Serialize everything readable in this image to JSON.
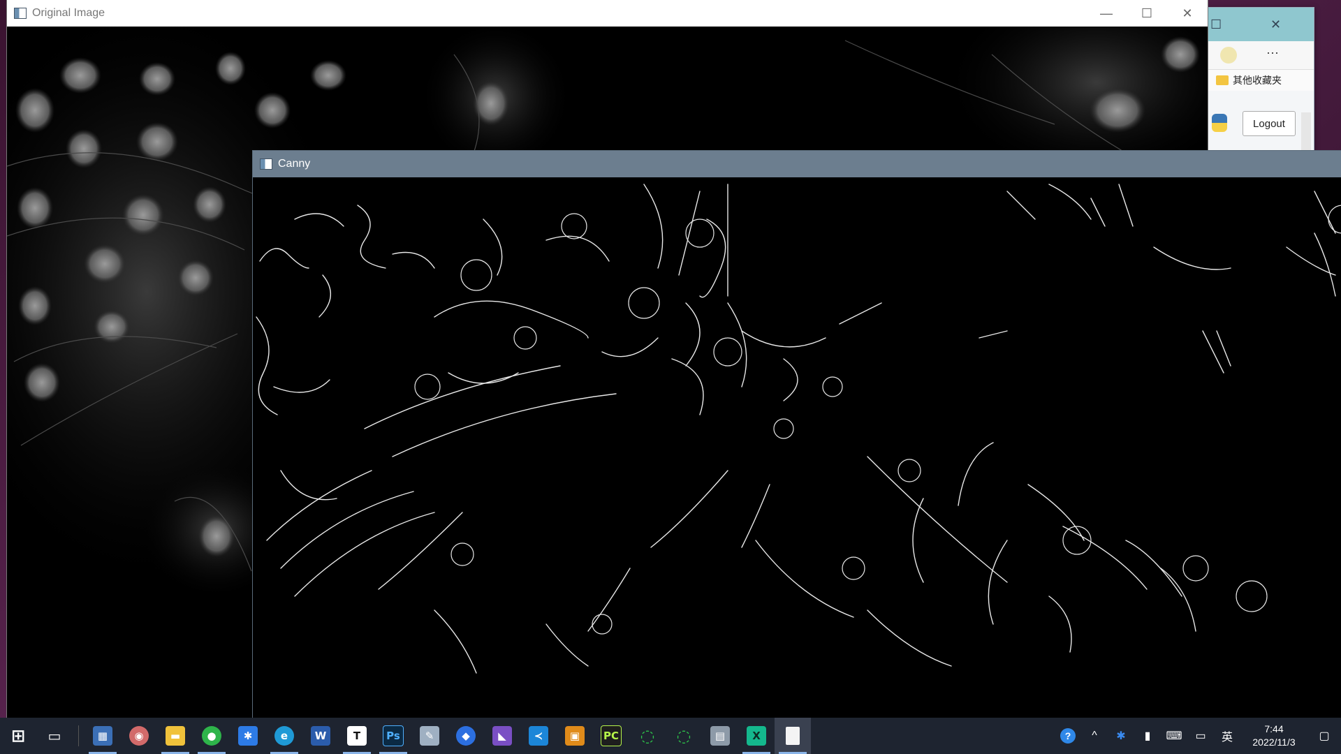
{
  "browser": {
    "favorites_folder_label": "其他收藏夹",
    "logout_label": "Logout",
    "more_label": "···"
  },
  "original_window": {
    "title": "Original Image",
    "minimize": "—",
    "maximize": "☐",
    "close": "✕"
  },
  "canny_window": {
    "title": "Canny"
  },
  "taskbar": {
    "apps": [
      {
        "name": "start-button",
        "glyph": "⊞",
        "color": "transparent"
      },
      {
        "name": "task-view-button",
        "glyph": "▭",
        "color": "transparent"
      },
      {
        "name": "calendar-app",
        "glyph": "▦",
        "color": "#3b6fb6"
      },
      {
        "name": "paint-app",
        "glyph": "◉",
        "color": "#d26a6a"
      },
      {
        "name": "file-explorer-app",
        "glyph": "▬",
        "color": "#f0c23b"
      },
      {
        "name": "wechat-app",
        "glyph": "●",
        "color": "#2eb44a"
      },
      {
        "name": "feishu-app",
        "glyph": "✱",
        "color": "#2d7be6"
      },
      {
        "name": "edge-app",
        "glyph": "e",
        "color": "#1f9ad6"
      },
      {
        "name": "word-app",
        "glyph": "W",
        "color": "#2b5cab"
      },
      {
        "name": "typora-app",
        "glyph": "T",
        "color": "#ffffff"
      },
      {
        "name": "photoshop-app",
        "glyph": "Ps",
        "color": "#0b2a44"
      },
      {
        "name": "notepad-app",
        "glyph": "✎",
        "color": "#9fb0c2"
      },
      {
        "name": "maps-app",
        "glyph": "◆",
        "color": "#2c6fe0"
      },
      {
        "name": "visual-studio-app",
        "glyph": "◣",
        "color": "#7a4fc4"
      },
      {
        "name": "vscode-app",
        "glyph": "≺",
        "color": "#1c86d8"
      },
      {
        "name": "remote-app",
        "glyph": "▣",
        "color": "#e08b1a"
      },
      {
        "name": "pycharm-app",
        "glyph": "PC",
        "color": "#1e1e1e"
      },
      {
        "name": "loader-app-1",
        "glyph": "◌",
        "color": "transparent"
      },
      {
        "name": "loader-app-2",
        "glyph": "◌",
        "color": "transparent"
      },
      {
        "name": "installer-app",
        "glyph": "▤",
        "color": "#8d9aa8"
      },
      {
        "name": "x-app",
        "glyph": "X",
        "color": "#14b88d"
      },
      {
        "name": "document-app",
        "glyph": "▯",
        "color": "transparent"
      }
    ],
    "tray": {
      "help_icon": "?",
      "chevron": "^",
      "feishu_icon": "✱",
      "battery_icon": "▮",
      "keyboard_icon": "⌨",
      "display_icon": "▭",
      "ime_label": "英",
      "time": "7:44",
      "date": "2022/11/3",
      "notification_icon": "▢"
    }
  }
}
